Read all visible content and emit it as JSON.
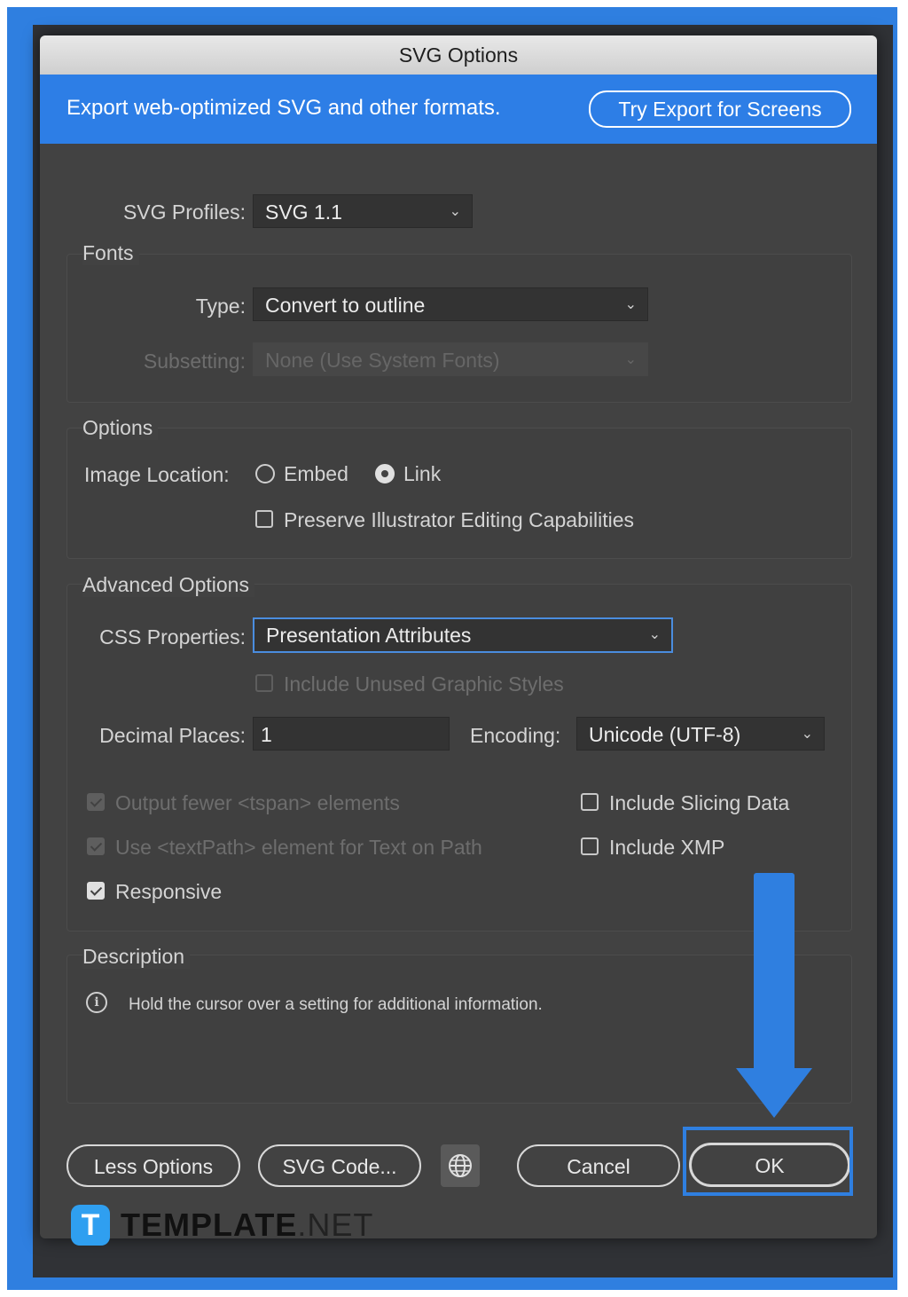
{
  "dialog": {
    "title": "SVG Options",
    "banner_text": "Export web-optimized SVG and other formats.",
    "banner_button": "Try Export for Screens"
  },
  "svg_profiles": {
    "label": "SVG Profiles:",
    "value": "SVG 1.1"
  },
  "fonts": {
    "title": "Fonts",
    "type_label": "Type:",
    "type_value": "Convert to outline",
    "subsetting_label": "Subsetting:",
    "subsetting_value": "None (Use System Fonts)"
  },
  "options": {
    "title": "Options",
    "image_location_label": "Image Location:",
    "embed_label": "Embed",
    "link_label": "Link",
    "image_location_selected": "Link",
    "preserve_label": "Preserve Illustrator Editing Capabilities",
    "preserve_checked": false
  },
  "advanced": {
    "title": "Advanced Options",
    "css_label": "CSS Properties:",
    "css_value": "Presentation Attributes",
    "unused_styles_label": "Include Unused Graphic Styles",
    "decimal_label": "Decimal Places:",
    "decimal_value": "1",
    "encoding_label": "Encoding:",
    "encoding_value": "Unicode (UTF-8)",
    "tspan_label": "Output fewer <tspan> elements",
    "textpath_label": "Use <textPath> element for Text on Path",
    "responsive_label": "Responsive",
    "slicing_label": "Include Slicing Data",
    "xmp_label": "Include XMP",
    "tspan_checked": true,
    "textpath_checked": true,
    "responsive_checked": true,
    "slicing_checked": false,
    "xmp_checked": false
  },
  "description": {
    "title": "Description",
    "text": "Hold the cursor over a setting for additional information."
  },
  "buttons": {
    "less_options": "Less Options",
    "svg_code": "SVG Code...",
    "cancel": "Cancel",
    "ok": "OK"
  },
  "watermark": {
    "brand": "TEMPLATE",
    "suffix": ".NET",
    "logo_letter": "T"
  },
  "colors": {
    "accent": "#2f7fe0",
    "dialog_bg": "#424242",
    "banner": "#2d7ee6"
  }
}
